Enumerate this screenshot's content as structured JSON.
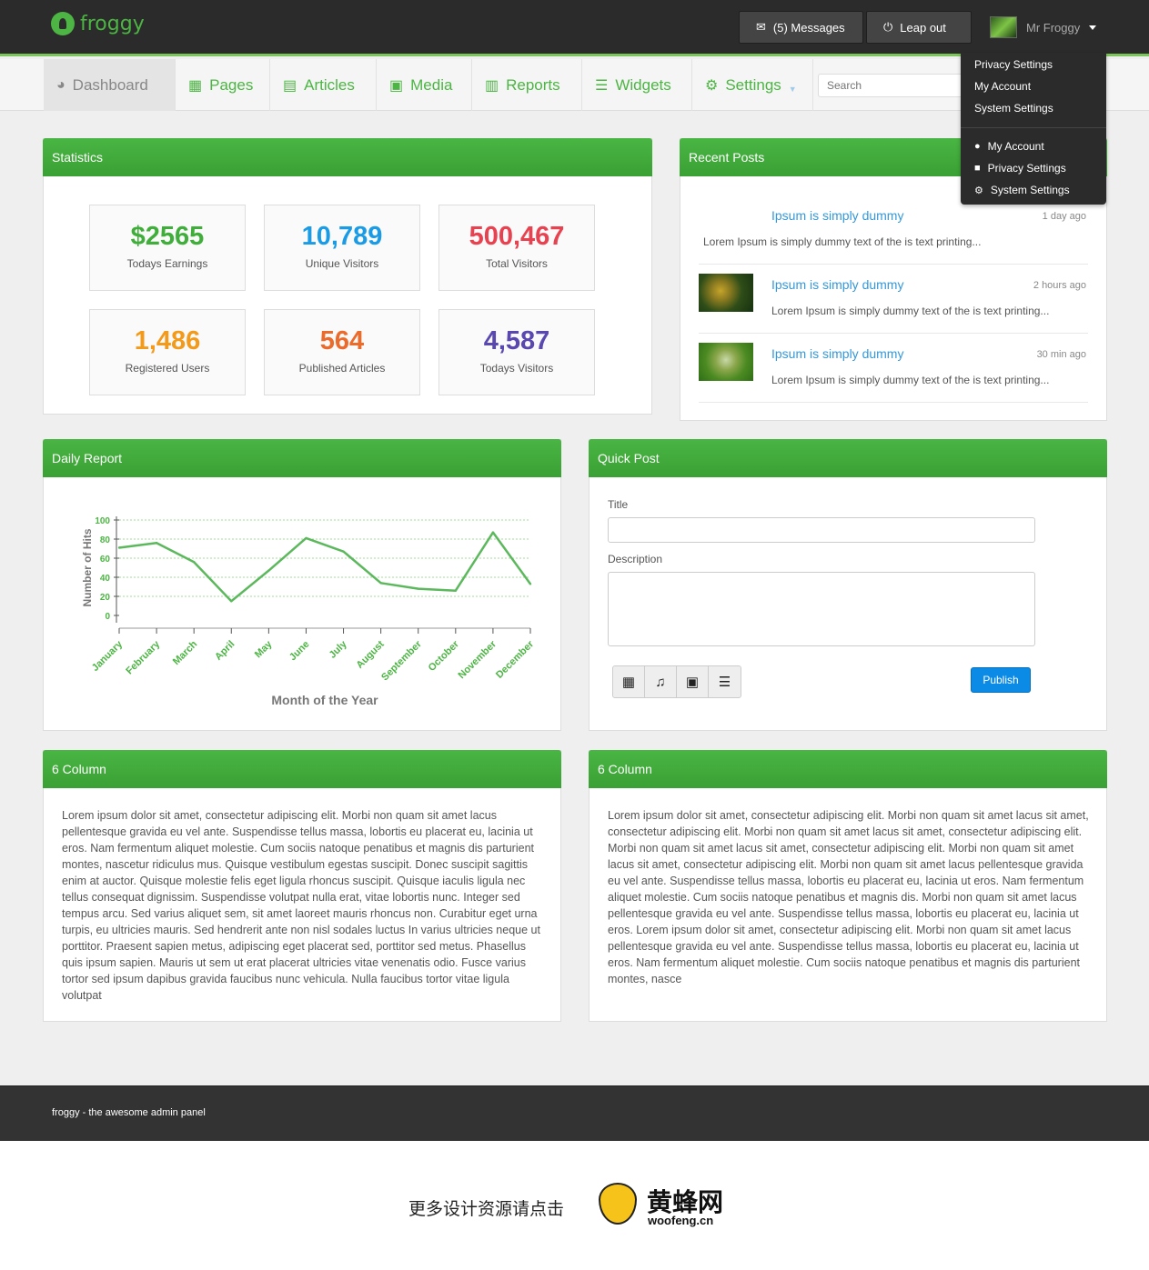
{
  "app": {
    "logo_text": "froggy"
  },
  "topbar": {
    "messages_label": "(5) Messages",
    "logout_label": "Leap out",
    "user_name": "Mr Froggy"
  },
  "nav": {
    "items": [
      {
        "label": "Dashboard",
        "icon": "dashboard-icon"
      },
      {
        "label": "Pages",
        "icon": "grid-icon"
      },
      {
        "label": "Articles",
        "icon": "document-icon"
      },
      {
        "label": "Media",
        "icon": "image-icon"
      },
      {
        "label": "Reports",
        "icon": "bar-chart-icon"
      },
      {
        "label": "Widgets",
        "icon": "list-icon"
      },
      {
        "label": "Settings",
        "icon": "gear-icon"
      }
    ],
    "search_placeholder": "Search"
  },
  "dropdown": {
    "plain_items": [
      "Privacy Settings",
      "My Account",
      "System Settings"
    ],
    "icon_items": [
      {
        "label": "My Account",
        "icon": "user-icon"
      },
      {
        "label": "Privacy Settings",
        "icon": "lock-icon"
      },
      {
        "label": "System Settings",
        "icon": "cogs-icon"
      }
    ]
  },
  "statistics": {
    "title": "Statistics",
    "items": [
      {
        "value": "$2565",
        "label": "Todays Earnings",
        "color": "#3fae3a"
      },
      {
        "value": "10,789",
        "label": "Unique Visitors",
        "color": "#1a9be6"
      },
      {
        "value": "500,467",
        "label": "Total Visitors",
        "color": "#e8414f"
      },
      {
        "value": "1,486",
        "label": "Registered Users",
        "color": "#f39a1a"
      },
      {
        "value": "564",
        "label": "Published Articles",
        "color": "#ec6a2a"
      },
      {
        "value": "4,587",
        "label": "Todays Visitors",
        "color": "#5a48b0"
      }
    ]
  },
  "recent_posts": {
    "title": "Recent Posts",
    "items": [
      {
        "title": "Ipsum is simply dummy",
        "time": "1 day ago",
        "text": "Lorem Ipsum is simply dummy text of the is text printing..."
      },
      {
        "title": "Ipsum is simply dummy",
        "time": "2 hours ago",
        "text": "Lorem Ipsum is simply dummy text of the is text printing..."
      },
      {
        "title": "Ipsum is simply dummy",
        "time": "30 min ago",
        "text": "Lorem Ipsum is simply dummy text of the is text printing..."
      }
    ]
  },
  "daily_report": {
    "title": "Daily Report"
  },
  "chart_data": {
    "type": "line",
    "categories": [
      "January",
      "February",
      "March",
      "April",
      "May",
      "June",
      "July",
      "August",
      "September",
      "October",
      "November",
      "December"
    ],
    "values": [
      71,
      76,
      56,
      15,
      47,
      81,
      67,
      34,
      28,
      26,
      87,
      33
    ],
    "xlabel": "Month of the Year",
    "ylabel": "Number of Hits",
    "ylim": [
      0,
      100
    ],
    "yticks": [
      0,
      20,
      40,
      60,
      80,
      100
    ],
    "grid": true,
    "color": "#5cb85c"
  },
  "quick_post": {
    "title": "Quick Post",
    "title_label": "Title",
    "description_label": "Description",
    "publish_label": "Publish",
    "toolbar_icons": [
      "film-icon",
      "music-icon",
      "picture-icon",
      "menu-lines-icon"
    ]
  },
  "column_left": {
    "title": "6 Column",
    "text": "Lorem ipsum dolor sit amet, consectetur adipiscing elit. Morbi non quam sit amet lacus pellentesque gravida eu vel ante. Suspendisse tellus massa, lobortis eu placerat eu, lacinia ut eros. Nam fermentum aliquet molestie. Cum sociis natoque penatibus et magnis dis parturient montes, nascetur ridiculus mus. Quisque vestibulum egestas suscipit. Donec suscipit sagittis enim at auctor. Quisque molestie felis eget ligula rhoncus suscipit. Quisque iaculis ligula nec tellus consequat dignissim. Suspendisse volutpat nulla erat, vitae lobortis nunc. Integer sed tempus arcu. Sed varius aliquet sem, sit amet laoreet mauris rhoncus non. Curabitur eget urna turpis, eu ultricies mauris. Sed hendrerit ante non nisl sodales luctus In varius ultricies neque ut porttitor. Praesent sapien metus, adipiscing eget placerat sed, porttitor sed metus. Phasellus quis ipsum sapien. Mauris ut sem ut erat placerat ultricies vitae venenatis odio. Fusce varius tortor sed ipsum dapibus gravida faucibus nunc vehicula. Nulla faucibus tortor vitae ligula volutpat"
  },
  "column_right": {
    "title": "6 Column",
    "text": "Lorem ipsum dolor sit amet, consectetur adipiscing elit. Morbi non quam sit amet lacus sit amet, consectetur adipiscing elit. Morbi non quam sit amet lacus sit amet, consectetur adipiscing elit. Morbi non quam sit amet lacus sit amet, consectetur adipiscing elit. Morbi non quam sit amet lacus sit amet, consectetur adipiscing elit. Morbi non quam sit amet lacus pellentesque gravida eu vel ante. Suspendisse tellus massa, lobortis eu placerat eu, lacinia ut eros. Nam fermentum aliquet molestie. Cum sociis natoque penatibus et magnis dis. Morbi non quam sit amet lacus pellentesque gravida eu vel ante. Suspendisse tellus massa, lobortis eu placerat eu, lacinia ut eros. Lorem ipsum dolor sit amet, consectetur adipiscing elit. Morbi non quam sit amet lacus pellentesque gravida eu vel ante. Suspendisse tellus massa, lobortis eu placerat eu, lacinia ut eros. Nam fermentum aliquet molestie. Cum sociis natoque penatibus et magnis dis parturient montes, nasce"
  },
  "footer": {
    "text": "froggy - the awesome admin panel"
  },
  "promo": {
    "text": "更多设计资源请点击",
    "brand": "黄蜂网",
    "brand_sub": "woofeng.cn"
  }
}
